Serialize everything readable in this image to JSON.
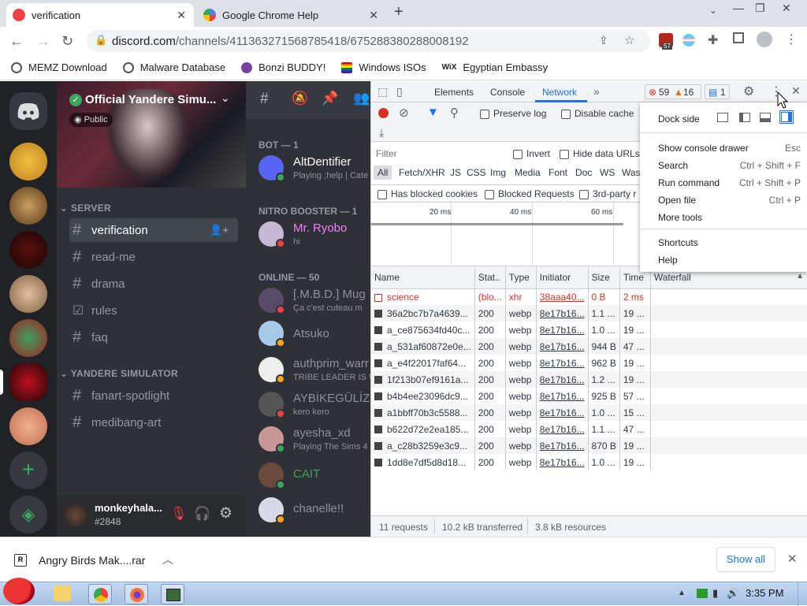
{
  "tabs": [
    {
      "title": "verification",
      "active": true
    },
    {
      "title": "Google Chrome Help",
      "active": false
    }
  ],
  "new_tab": "+",
  "url": {
    "host": "discord.com",
    "path": "/channels/411363271568785418/675288380288008192"
  },
  "ext_badge": "57",
  "bookmarks": [
    "MEMZ Download",
    "Malware Database",
    "Bonzi BUDDY!",
    "Windows ISOs",
    "Egyptian Embassy"
  ],
  "discord": {
    "server_name": "Official Yandere Simu...",
    "public_label": "Public",
    "categories": [
      "SERVER",
      "YANDERE SIMULATOR"
    ],
    "channels_server": [
      {
        "name": "verification",
        "type": "text",
        "selected": true
      },
      {
        "name": "read-me",
        "type": "text"
      },
      {
        "name": "drama",
        "type": "text"
      },
      {
        "name": "rules",
        "type": "rules"
      },
      {
        "name": "faq",
        "type": "text"
      }
    ],
    "channels_yandere": [
      "fanart-spotlight",
      "medibang-art"
    ],
    "user": {
      "name": "monkeyhala...",
      "tag": "#2848"
    },
    "member_groups": [
      "BOT — 1",
      "NITRO BOOSTER — 1",
      "ONLINE — 50"
    ],
    "members": [
      {
        "name": "AltDentifier",
        "status": "Playing ;help | Cate",
        "color": "#ffffff",
        "dot": "#3ba55d"
      },
      {
        "name": "Mr. Ryobo",
        "status": "hi",
        "color": "#f47fff",
        "dot": "#ed4245"
      },
      {
        "name": "[.M.B.D.] Mug",
        "status": "Ça c'est cuteau m",
        "color": "#8e9297",
        "dot": "#ed4245"
      },
      {
        "name": "Atsuko",
        "status": "",
        "color": "#8e9297",
        "dot": "#faa61a"
      },
      {
        "name": "authprim_warr",
        "status": "TRIBE LEADER IS W",
        "color": "#8e9297",
        "dot": "#faa61a"
      },
      {
        "name": "AYBİKEGÜLİZ",
        "status": "kero kero",
        "color": "#8e9297",
        "dot": "#ed4245"
      },
      {
        "name": "ayesha_xd",
        "status": "Playing The Sims 4",
        "color": "#8e9297",
        "dot": "#3ba55d"
      },
      {
        "name": "CAIT",
        "status": "",
        "color": "#3ba55d",
        "dot": "#3ba55d"
      },
      {
        "name": "chanelle!!",
        "status": "",
        "color": "#8e9297",
        "dot": "#faa61a"
      }
    ]
  },
  "devtools": {
    "tabs": [
      "Elements",
      "Console",
      "Network"
    ],
    "errors": "59",
    "warnings": "16",
    "messages": "1",
    "preserve_log": "Preserve log",
    "disable_cache": "Disable cache",
    "filter_placeholder": "Filter",
    "invert": "Invert",
    "hide_data_urls": "Hide data URLs",
    "type_filters": [
      "All",
      "Fetch/XHR",
      "JS",
      "CSS",
      "Img",
      "Media",
      "Font",
      "Doc",
      "WS",
      "Was"
    ],
    "blocked_cookies": "Has blocked cookies",
    "blocked_requests": "Blocked Requests",
    "third_party": "3rd-party r",
    "timeline": [
      "20 ms",
      "40 ms",
      "60 ms"
    ],
    "columns": [
      "Name",
      "Stat..",
      "Type",
      "Initiator",
      "Size",
      "Time",
      "Waterfall"
    ],
    "rows": [
      {
        "name": "science",
        "status": "(blo...",
        "type": "xhr",
        "initiator": "38aaa40...",
        "size": "0 B",
        "time": "2 ms",
        "error": true
      },
      {
        "name": "36a2bc7b7a4639...",
        "status": "200",
        "type": "webp",
        "initiator": "8e17b16...",
        "size": "1.1 ...",
        "time": "19 ..."
      },
      {
        "name": "a_ce875634fd40c...",
        "status": "200",
        "type": "webp",
        "initiator": "8e17b16...",
        "size": "1.0 ...",
        "time": "19 ..."
      },
      {
        "name": "a_531af60872e0e...",
        "status": "200",
        "type": "webp",
        "initiator": "8e17b16...",
        "size": "944 B",
        "time": "47 ..."
      },
      {
        "name": "a_e4f22017faf64...",
        "status": "200",
        "type": "webp",
        "initiator": "8e17b16...",
        "size": "962 B",
        "time": "19 ..."
      },
      {
        "name": "1f213b07ef9161a...",
        "status": "200",
        "type": "webp",
        "initiator": "8e17b16...",
        "size": "1.2 ...",
        "time": "19 ..."
      },
      {
        "name": "b4b4ee23096dc9...",
        "status": "200",
        "type": "webp",
        "initiator": "8e17b16...",
        "size": "925 B",
        "time": "57 ..."
      },
      {
        "name": "a1bbff70b3c5588...",
        "status": "200",
        "type": "webp",
        "initiator": "8e17b16...",
        "size": "1.0 ...",
        "time": "15 ..."
      },
      {
        "name": "b622d72e2ea185...",
        "status": "200",
        "type": "webp",
        "initiator": "8e17b16...",
        "size": "1.1 ...",
        "time": "47 ..."
      },
      {
        "name": "a_c28b3259e3c9...",
        "status": "200",
        "type": "webp",
        "initiator": "8e17b16...",
        "size": "870 B",
        "time": "19 ..."
      },
      {
        "name": "1dd8e7df5d8d18...",
        "status": "200",
        "type": "webp",
        "initiator": "8e17b16...",
        "size": "1.0 ...",
        "time": "19 ..."
      }
    ],
    "status": {
      "requests": "11 requests",
      "transferred": "10.2 kB transferred",
      "resources": "3.8 kB resources"
    }
  },
  "menu": {
    "dock_side": "Dock side",
    "items": [
      {
        "label": "Show console drawer",
        "key": "Esc"
      },
      {
        "label": "Search",
        "key": "Ctrl + Shift + F"
      },
      {
        "label": "Run command",
        "key": "Ctrl + Shift + P"
      },
      {
        "label": "Open file",
        "key": "Ctrl + P"
      },
      {
        "label": "More tools",
        "key": ""
      },
      {
        "label": "Shortcuts",
        "key": ""
      },
      {
        "label": "Help",
        "key": ""
      }
    ]
  },
  "download": {
    "file": "Angry Birds Mak....rar",
    "show_all": "Show all"
  },
  "taskbar": {
    "clock": "3:35 PM"
  }
}
